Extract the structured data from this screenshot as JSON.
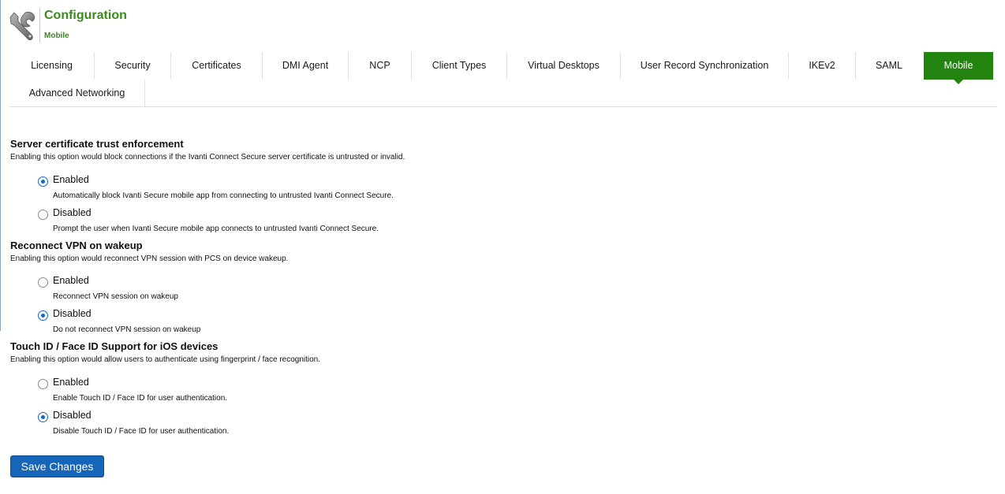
{
  "header": {
    "title": "Configuration",
    "subtitle": "Mobile",
    "icon": "wrench-icon"
  },
  "tabs": [
    {
      "label": "Licensing",
      "active": false
    },
    {
      "label": "Security",
      "active": false
    },
    {
      "label": "Certificates",
      "active": false
    },
    {
      "label": "DMI Agent",
      "active": false
    },
    {
      "label": "NCP",
      "active": false
    },
    {
      "label": "Client Types",
      "active": false
    },
    {
      "label": "Virtual Desktops",
      "active": false
    },
    {
      "label": "User Record Synchronization",
      "active": false
    },
    {
      "label": "IKEv2",
      "active": false
    },
    {
      "label": "SAML",
      "active": false
    },
    {
      "label": "Mobile",
      "active": true
    },
    {
      "label": "Advanced Networking",
      "active": false
    }
  ],
  "sections": [
    {
      "title": "Server certificate trust enforcement",
      "description": "Enabling this option would block connections if the Ivanti Connect Secure server certificate is untrusted or invalid.",
      "options": [
        {
          "label": "Enabled",
          "help": "Automatically block Ivanti Secure mobile app from connecting to untrusted Ivanti Connect Secure.",
          "checked": true
        },
        {
          "label": "Disabled",
          "help": "Prompt the user when Ivanti Secure mobile app connects to untrusted Ivanti Connect Secure.",
          "checked": false
        }
      ]
    },
    {
      "title": "Reconnect VPN on wakeup",
      "description": "Enabling this option would reconnect VPN session with PCS on device wakeup.",
      "options": [
        {
          "label": "Enabled",
          "help": "Reconnect VPN session on wakeup",
          "checked": false
        },
        {
          "label": "Disabled",
          "help": "Do not reconnect VPN session on wakeup",
          "checked": true
        }
      ]
    },
    {
      "title": "Touch ID / Face ID Support for iOS devices",
      "description": "Enabling this option would allow users to authenticate using fingerprint / face recognition.",
      "options": [
        {
          "label": "Enabled",
          "help": "Enable Touch ID / Face ID for user authentication.",
          "checked": false
        },
        {
          "label": "Disabled",
          "help": "Disable Touch ID / Face ID for user authentication.",
          "checked": true
        }
      ]
    }
  ],
  "save_button": {
    "label": "Save Changes"
  },
  "colors": {
    "brand_green": "#3a8a1e",
    "active_tab": "#22840e",
    "primary_button": "#1565b8",
    "radio_checked": "#1a67c8"
  }
}
